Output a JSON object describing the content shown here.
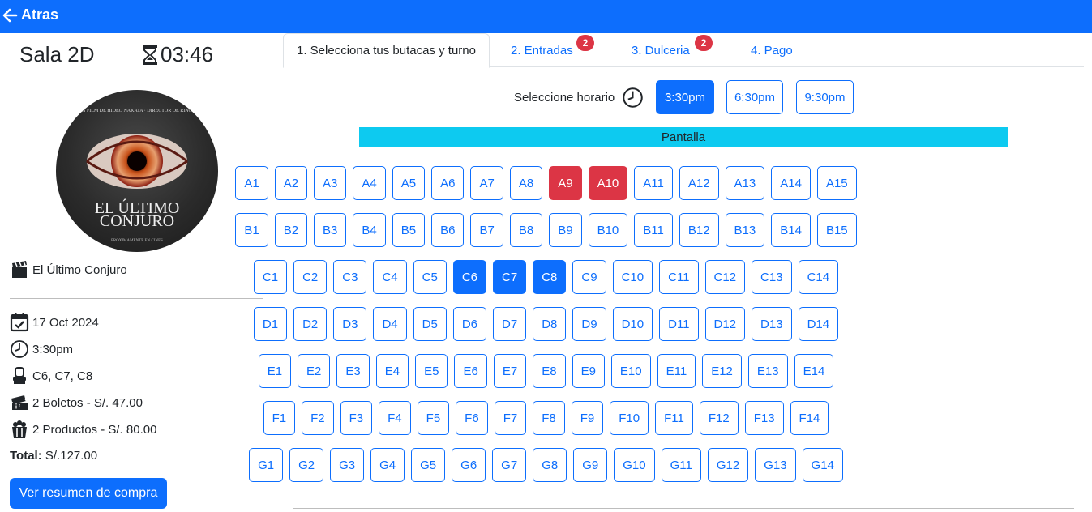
{
  "topbar": {
    "back_label": "Atras"
  },
  "sala": {
    "name": "Sala 2D",
    "timer": "03:46"
  },
  "poster": {
    "top_text": "UN FILM DE HIDEO NAKATA · DIRECTOR DE RINGU",
    "title_line1": "EL ÚLTIMO",
    "title_line2": "CONJURO",
    "bottom_text": "PROXIMAMENTE EN CINES"
  },
  "summary": {
    "movie": "El Último Conjuro",
    "date": "17 Oct 2024",
    "time": "3:30pm",
    "seats": "C6, C7, C8",
    "tickets": "2 Boletos - S/. 47.00",
    "products": "2 Productos - S/. 80.00",
    "total_label": "Total:",
    "total_value": "S/.127.00",
    "button": "Ver resumen de compra"
  },
  "tabs": [
    {
      "label": "1. Selecciona tus butacas y turno",
      "active": true
    },
    {
      "label": "2. Entradas",
      "badge": "2"
    },
    {
      "label": "3. Dulceria",
      "badge": "2"
    },
    {
      "label": "4. Pago"
    }
  ],
  "horario": {
    "label": "Seleccione horario",
    "options": [
      "3:30pm",
      "6:30pm",
      "9:30pm"
    ],
    "selected": "3:30pm"
  },
  "screen_label": "Pantalla",
  "seats": {
    "rows": [
      {
        "row": "A",
        "count": 15
      },
      {
        "row": "B",
        "count": 15
      },
      {
        "row": "C",
        "count": 14
      },
      {
        "row": "D",
        "count": 14
      },
      {
        "row": "E",
        "count": 14
      },
      {
        "row": "F",
        "count": 14
      },
      {
        "row": "G",
        "count": 14
      }
    ],
    "taken": [
      "A9",
      "A10"
    ],
    "selected": [
      "C6",
      "C7",
      "C8"
    ]
  },
  "colors": {
    "primary": "#0d6efd",
    "danger": "#dc3545",
    "info": "#0dcaf0"
  }
}
